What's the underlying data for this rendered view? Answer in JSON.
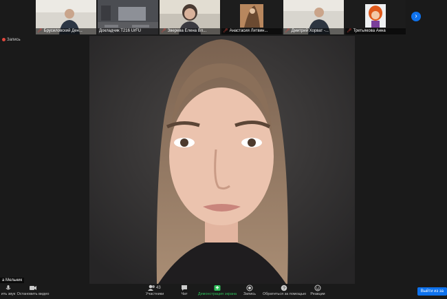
{
  "participants": [
    {
      "name": "Брусиловский Ден..."
    },
    {
      "name": "Докладчик T216 UrFU"
    },
    {
      "name": "Зверева Елена Вл..."
    },
    {
      "name": "Анастасия Литвин..."
    },
    {
      "name": "Дмитрий Хорват -..."
    },
    {
      "name": "Третьякова Анна"
    }
  ],
  "recording": {
    "label": "Запись"
  },
  "speaker": {
    "name": "а Мельник"
  },
  "toolbar": {
    "unmute": "ить звук",
    "video": "Остановить видео",
    "participants": "Участники",
    "participants_count": "43",
    "chat": "Чат",
    "share": "Демонстрация экрана",
    "record": "Запись",
    "help": "Обратиться за помощью",
    "reactions": "Реакции",
    "leave": "Выйти из за"
  },
  "colors": {
    "accent": "#0e72ed",
    "share": "#2fbf5a",
    "muted": "#e0483e"
  }
}
